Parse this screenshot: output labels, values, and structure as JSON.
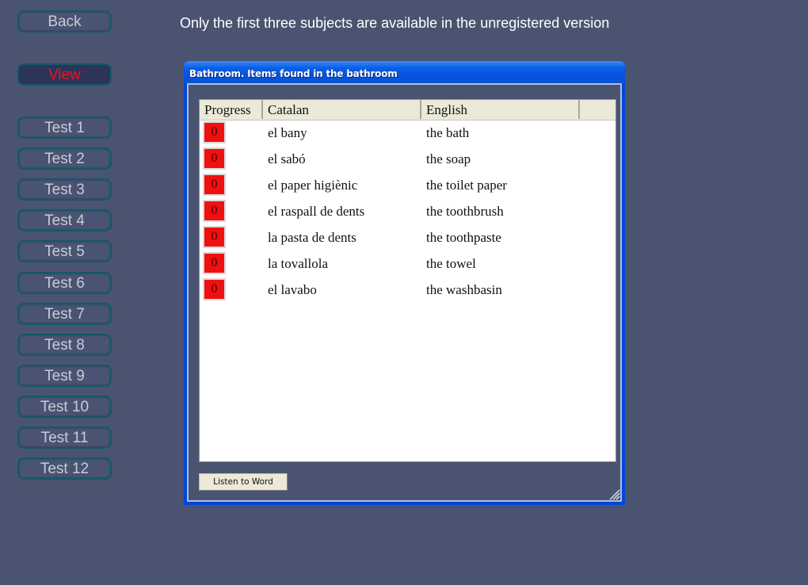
{
  "nav": {
    "back": "Back",
    "view": "View",
    "tests": [
      "Test 1",
      "Test 2",
      "Test 3",
      "Test 4",
      "Test 5",
      "Test 6",
      "Test 7",
      "Test 8",
      "Test 9",
      "Test 10",
      "Test 11",
      "Test 12"
    ]
  },
  "notice": "Only the first three subjects are available in the unregistered version",
  "window": {
    "title": "Bathroom. Items found in the bathroom",
    "columns": [
      "Progress",
      "Catalan",
      "English"
    ],
    "rows": [
      {
        "progress": "0",
        "catalan": "el bany",
        "english": "the bath"
      },
      {
        "progress": "0",
        "catalan": "el sabó",
        "english": "the soap"
      },
      {
        "progress": "0",
        "catalan": "el paper higiènic",
        "english": "the toilet paper"
      },
      {
        "progress": "0",
        "catalan": "el raspall de dents",
        "english": "the toothbrush"
      },
      {
        "progress": "0",
        "catalan": "la pasta de dents",
        "english": "the toothpaste"
      },
      {
        "progress": "0",
        "catalan": "la tovallola",
        "english": "the towel"
      },
      {
        "progress": "0",
        "catalan": "el lavabo",
        "english": "the washbasin"
      }
    ],
    "listen_button": "Listen to Word"
  },
  "colors": {
    "background": "#4a5470",
    "active_nav_text": "#e8141e",
    "progress_fill": "#f01010",
    "titlebar": "#0451dc"
  }
}
